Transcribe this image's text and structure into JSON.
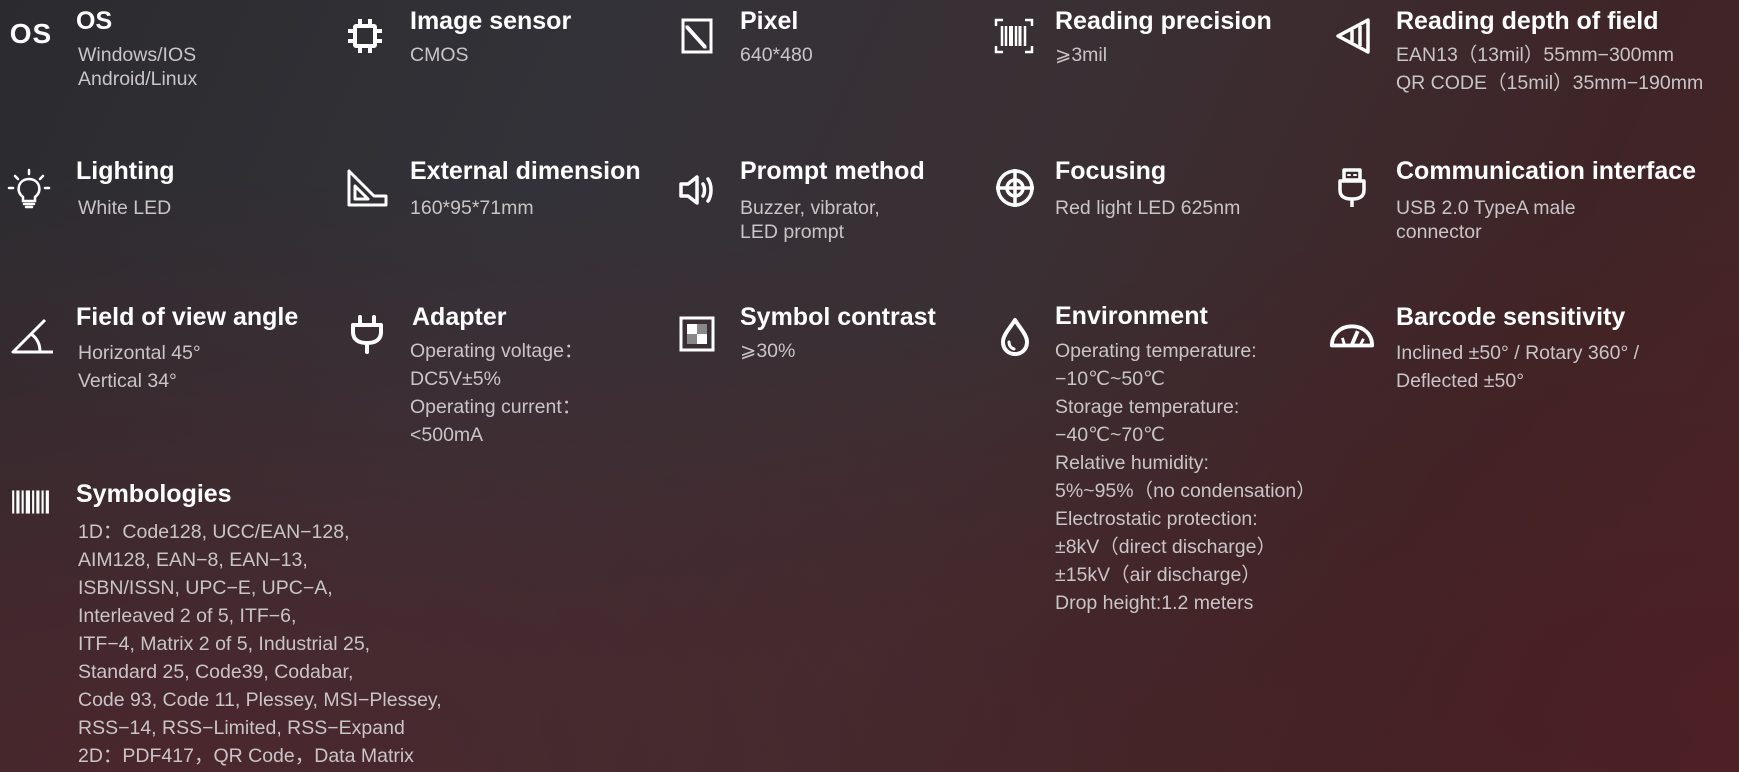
{
  "colors": {
    "title": "#ffffff",
    "description": "#c9c5c6",
    "icon": "#ffffff",
    "background_dark": "#2b2b2f",
    "background_red": "#4a2326"
  },
  "specs": {
    "os": {
      "icon_label": "OS",
      "title": "OS",
      "lines": [
        "Windows/IOS",
        "Android/Linux"
      ]
    },
    "image_sensor": {
      "icon": "chip-icon",
      "title": "Image sensor",
      "lines": [
        "CMOS"
      ]
    },
    "pixel": {
      "icon": "pixel-frame-icon",
      "title": "Pixel",
      "lines": [
        "640*480"
      ]
    },
    "reading_precision": {
      "icon": "barcode-scan-icon",
      "title": "Reading precision",
      "lines": [
        "⩾3mil"
      ]
    },
    "reading_depth": {
      "icon": "depth-of-field-icon",
      "title": "Reading depth of field",
      "lines": [
        "EAN13（13mil）55mm−300mm",
        "QR CODE（15mil）35mm−190mm"
      ]
    },
    "lighting": {
      "icon": "light-bulb-icon",
      "title": "Lighting",
      "lines": [
        "White LED"
      ]
    },
    "external_dimension": {
      "icon": "dimension-ruler-icon",
      "title": "External dimension",
      "lines": [
        "160*95*71mm"
      ]
    },
    "prompt_method": {
      "icon": "speaker-icon",
      "title": "Prompt method",
      "lines": [
        "Buzzer, vibrator,",
        "LED prompt"
      ]
    },
    "focusing": {
      "icon": "crosshair-icon",
      "title": "Focusing",
      "lines": [
        "Red light LED 625nm"
      ]
    },
    "communication_interface": {
      "icon": "usb-plug-icon",
      "title": "Communication interface",
      "lines": [
        "USB 2.0 TypeA male",
        "connector"
      ]
    },
    "field_of_view": {
      "icon": "angle-icon",
      "title": "Field of view angle",
      "lines": [
        "Horizontal 45°",
        "Vertical 34°"
      ]
    },
    "adapter": {
      "icon": "power-plug-icon",
      "title": "Adapter",
      "lines": [
        "Operating voltage：",
        "DC5V±5%",
        "Operating current：",
        "<500mA"
      ]
    },
    "symbol_contrast": {
      "icon": "contrast-square-icon",
      "title": "Symbol contrast",
      "lines": [
        "⩾30%"
      ]
    },
    "environment": {
      "icon": "water-drop-icon",
      "title": "Environment",
      "lines": [
        "Operating temperature:",
        "−10℃~50℃",
        "Storage temperature:",
        "−40℃~70℃",
        "Relative humidity:",
        "5%~95%（no condensation）",
        "Electrostatic protection:",
        "±8kV（direct discharge）",
        "±15kV（air discharge）",
        "Drop height:1.2 meters"
      ]
    },
    "barcode_sensitivity": {
      "icon": "protractor-icon",
      "title": "Barcode sensitivity",
      "lines": [
        "Inclined ±50° / Rotary 360° /",
        "Deflected ±50°"
      ]
    },
    "symbologies": {
      "icon": "barcode-icon",
      "title": "Symbologies",
      "lines": [
        "1D：Code128, UCC/EAN−128,",
        "AIM128, EAN−8, EAN−13,",
        "ISBN/ISSN, UPC−E, UPC−A,",
        "Interleaved 2 of 5, ITF−6,",
        "ITF−4, Matrix 2 of 5, Industrial 25,",
        "Standard 25, Code39, Codabar,",
        "Code 93, Code 11, Plessey, MSI−Plessey,",
        "RSS−14, RSS−Limited, RSS−Expand",
        "2D：PDF417，QR Code，Data Matrix"
      ]
    }
  }
}
